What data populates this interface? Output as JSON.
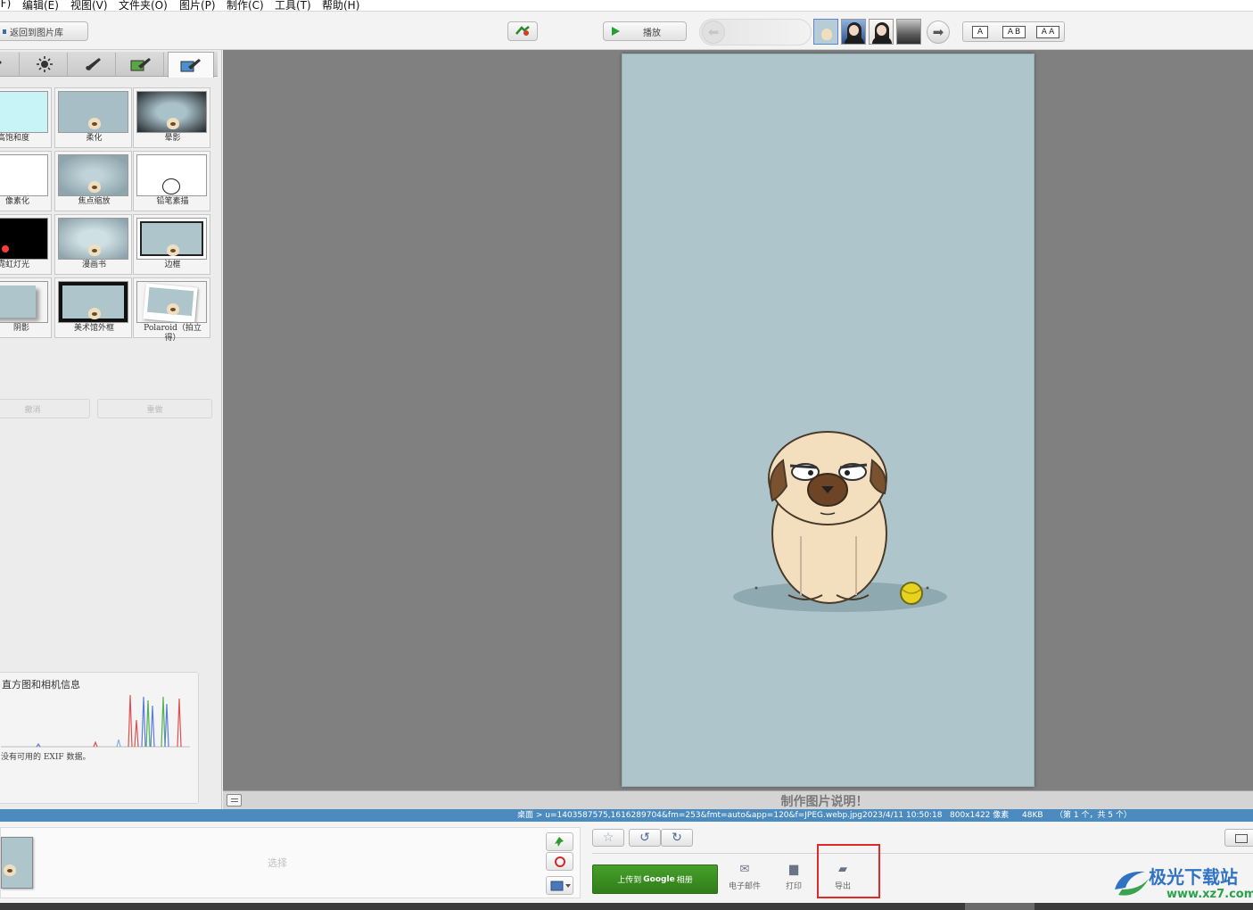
{
  "menu": [
    "(F)",
    "编辑(E)",
    "视图(V)",
    "文件夹(O)",
    "图片(P)",
    "制作(C)",
    "工具(T)",
    "帮助(H)"
  ],
  "toolbar": {
    "back_label": "返回到图片库",
    "play_label": "播放",
    "layout_options": [
      "A",
      "AB",
      "AA"
    ]
  },
  "effects": [
    {
      "label": "提高饱和度",
      "style": "saturated"
    },
    {
      "label": "柔化",
      "style": "soft"
    },
    {
      "label": "晕影",
      "style": "vignette"
    },
    {
      "label": "像素化",
      "style": "pixelate"
    },
    {
      "label": "焦点缩放",
      "style": "focal"
    },
    {
      "label": "铅笔素描",
      "style": "sketch"
    },
    {
      "label": "霓虹灯光",
      "style": "neon"
    },
    {
      "label": "漫画书",
      "style": "comic"
    },
    {
      "label": "边框",
      "style": "border"
    },
    {
      "label": "阴影",
      "style": "shadow"
    },
    {
      "label": "美术馆外框",
      "style": "gallery"
    },
    {
      "label": "Polaroid（拍立得）",
      "style": "polaroid"
    }
  ],
  "edit": {
    "undo_label": "撤消",
    "redo_label": "重做"
  },
  "histogram": {
    "title": "直方图和相机信息",
    "exif_text": "没有可用的 EXIF 数据。"
  },
  "caption": {
    "placeholder": "制作图片说明！"
  },
  "status": {
    "path": "桌面 > u=1403587575,1616289704&fm=253&fmt=auto&app=120&f=JPEG.webp.jpg",
    "datetime": "2023/4/11 10:50:18",
    "dimensions": "800x1422 像素",
    "filesize": "48KB",
    "position": "（第 1 个，共 5 个）"
  },
  "tray": {
    "select_label": "选择"
  },
  "actions": {
    "upload_prefix": "上传到",
    "upload_brand": "Google",
    "upload_suffix": "相册",
    "email_label": "电子邮件",
    "print_label": "打印",
    "export_label": "导出"
  },
  "watermark": {
    "name": "极光下载站",
    "url": "www.xz7.com"
  },
  "colors": {
    "status_bar": "#4b8bc0",
    "upload_button": "#3a8f22",
    "photo_bg": "#aec5cc",
    "highlight": "#e02a2a"
  }
}
